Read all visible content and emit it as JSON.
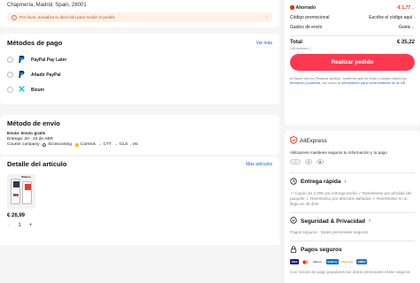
{
  "address": {
    "line": "Chapinería, Madrid, Spain, 28001",
    "warning": "Por favor, actualiza tu dirección para recibir el pedido"
  },
  "payment": {
    "title": "Métodos de pago",
    "more_link": "Ver más",
    "options": [
      {
        "label": "PayPal Pay Later",
        "icon": "paypal-icon"
      },
      {
        "label": "Añadir PayPal",
        "icon": "paypal-icon"
      },
      {
        "label": "Bizum",
        "icon": "bizum-icon"
      }
    ]
  },
  "shipping": {
    "title": "Método de envío",
    "line1_label": "Envío:",
    "line1_value": "Envío gratis",
    "line2": "Entrega: 20 - 23 de ABR",
    "courier_label": "Courier company:",
    "couriers": [
      "Ecoscooting",
      "Correos",
      "CTT",
      "GLS",
      "etc"
    ]
  },
  "detail": {
    "title": "Detalle del artículo",
    "more_link": "Más artículos",
    "product_brand": "Whatsu",
    "price": "€ 26,99",
    "quantity": "1",
    "minus": "−",
    "plus": "+"
  },
  "summary": {
    "saved_label": "Ahorrado",
    "saved_value": "-€ 1,77",
    "promo_label": "Código promocional",
    "promo_value": "Escribe el código aquí",
    "shipping_label": "Gastos de envío",
    "shipping_value": "Gratis",
    "total_label": "Total",
    "total_value": "€ 25,22",
    "iva": "IVA incluido",
    "cta": "Realizar pedido",
    "legal_1": "Al hacer clic en 'Realizar pedido', confirmo que he leído y acepto todos los ",
    "legal_link1": "términos y políticas",
    "legal_2": ", así como la ",
    "legal_link2": "información para consumidores en la UE."
  },
  "trust": {
    "brand": "AliExpress",
    "brand_sub": "AliExpress mantiene seguros tu información y tu pago",
    "delivery_title": "Entrega rápida",
    "delivery_text_1": "Cupón de 1,00€ por entrega tardía",
    "delivery_text_2": "Reembolso por pérdida del paquete",
    "delivery_text_3": "Reembolso por artículos dañados",
    "delivery_text_4": "Reembolso si no llega en 35 días",
    "security_title": "Seguridad & Privacidad",
    "security_text": "Pagos seguros · Datos personales seguros",
    "payments_title": "Pagos seguros",
    "payments_text": "Con socios de pago populares tus datos personales están seguros",
    "payment_brands": [
      "VISA",
      "Mastercard",
      "Diners",
      "SafeKey",
      "Discover",
      "AMEX"
    ]
  },
  "colors": {
    "accent": "#fd384f",
    "saved_red": "#e62e04",
    "link_blue": "#1a5ce5",
    "ok_green": "#1aa24c"
  }
}
